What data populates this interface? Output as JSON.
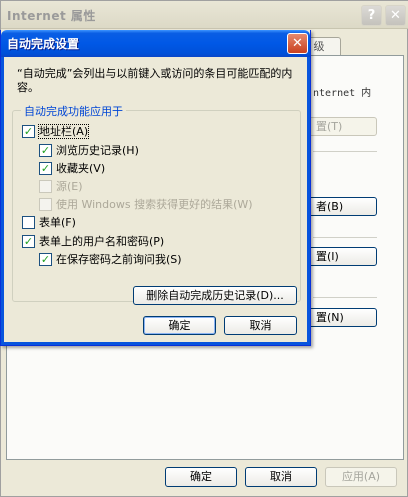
{
  "background_window": {
    "title": "Internet 属性",
    "help_icon_glyph": "?",
    "close_icon_glyph": "✕",
    "tab_label": "级",
    "content_text": "nternet 内",
    "buttons": [
      {
        "label": "置(T)",
        "disabled": true
      },
      {
        "label": "者(B)",
        "disabled": false
      },
      {
        "label": "置(I)",
        "disabled": false
      },
      {
        "label": "置(N)",
        "disabled": false
      }
    ],
    "footer": {
      "ok_label": "确定",
      "cancel_label": "取消",
      "apply_label": "应用(A)"
    }
  },
  "dialog": {
    "title": "自动完成设置",
    "close_icon_glyph": "✕",
    "description": "“自动完成”会列出与以前键入或访问的条目可能匹配的内容。",
    "group_title": "自动完成功能应用于",
    "options": [
      {
        "label": "地址栏(A)",
        "checked": true,
        "disabled": false
      },
      {
        "label": "浏览历史记录(H)",
        "checked": true,
        "disabled": false
      },
      {
        "label": "收藏夹(V)",
        "checked": true,
        "disabled": false
      },
      {
        "label": "源(E)",
        "checked": false,
        "disabled": true
      },
      {
        "label": "使用 Windows 搜索获得更好的结果(W)",
        "checked": false,
        "disabled": true
      },
      {
        "label": "表单(F)",
        "checked": false,
        "disabled": false
      },
      {
        "label": "表单上的用户名和密码(P)",
        "checked": true,
        "disabled": false
      },
      {
        "label": "在保存密码之前询问我(S)",
        "checked": true,
        "disabled": false
      }
    ],
    "delete_history_label": "删除自动完成历史记录(D)...",
    "ok_label": "确定",
    "cancel_label": "取消"
  },
  "colors": {
    "titlebar_active": "#0058e6",
    "group_title": "#0046d5",
    "checkmark": "#21a121",
    "face": "#ece9d8"
  }
}
